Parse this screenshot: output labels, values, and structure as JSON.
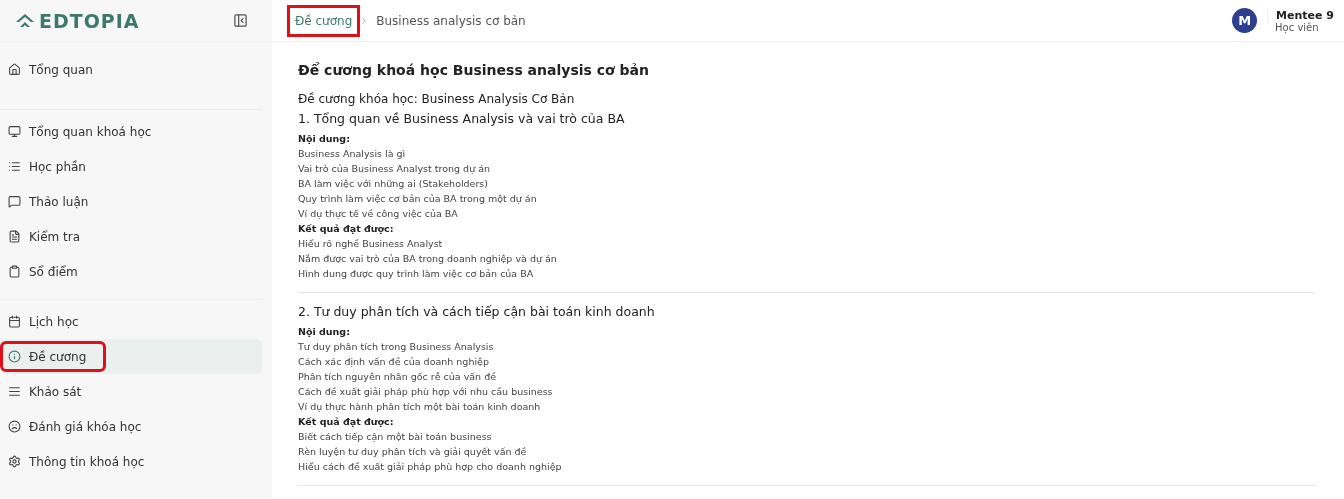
{
  "logo": {
    "text": "EDTOPIA"
  },
  "sidebar": {
    "groups": [
      {
        "items": [
          {
            "label": "Tổng quan",
            "selected": false,
            "highlighted": false
          }
        ]
      },
      {
        "items": [
          {
            "label": "Tổng quan khoá học",
            "selected": false,
            "highlighted": false
          },
          {
            "label": "Học phần",
            "selected": false,
            "highlighted": false
          },
          {
            "label": "Thảo luận",
            "selected": false,
            "highlighted": false
          },
          {
            "label": "Kiểm tra",
            "selected": false,
            "highlighted": false
          },
          {
            "label": "Sổ điểm",
            "selected": false,
            "highlighted": false
          }
        ]
      },
      {
        "items": [
          {
            "label": "Lịch học",
            "selected": false,
            "highlighted": false
          },
          {
            "label": "Đề cương",
            "selected": true,
            "highlighted": true
          },
          {
            "label": "Khảo sát",
            "selected": false,
            "highlighted": false
          },
          {
            "label": "Đánh giá khóa học",
            "selected": false,
            "highlighted": false
          },
          {
            "label": "Thông tin khoá học",
            "selected": false,
            "highlighted": false
          }
        ]
      }
    ]
  },
  "breadcrumb": [
    {
      "label": "Đề cương",
      "link": true,
      "highlighted": true
    },
    {
      "label": "Business analysis cơ bản",
      "link": false,
      "highlighted": false
    }
  ],
  "user": {
    "initial": "M",
    "name": "Mentee 9",
    "role": "Học viên"
  },
  "page": {
    "title": "Để cương khoá học Business analysis cơ bản",
    "intro": "Đề cương khóa học: Business Analysis Cơ Bản",
    "sections": [
      {
        "heading": "1. Tổng quan về Business Analysis và vai trò của BA",
        "groups": [
          {
            "label": "Nội dung:",
            "items": [
              "Business Analysis là gì",
              "Vai trò của Business Analyst trong dự án",
              "BA làm việc với những ai (Stakeholders)",
              "Quy trình làm việc cơ bản của BA trong một dự án",
              "Ví dụ thực tế về công việc của BA"
            ]
          },
          {
            "label": "Kết quả đạt được:",
            "items": [
              "Hiểu rõ nghề Business Analyst",
              "Nắm được vai trò của BA trong doanh nghiệp và dự án",
              "Hình dung được quy trình làm việc cơ bản của BA"
            ]
          }
        ]
      },
      {
        "heading": "2. Tư duy phân tích và cách tiếp cận bài toán kinh doanh",
        "groups": [
          {
            "label": "Nội dung:",
            "items": [
              "Tư duy phân tích trong Business Analysis",
              "Cách xác định vấn đề của doanh nghiệp",
              "Phân tích nguyên nhân gốc rễ của vấn đề",
              "Cách đề xuất giải pháp phù hợp với nhu cầu business",
              "Ví dụ thực hành phân tích một bài toán kinh doanh"
            ]
          },
          {
            "label": "Kết quả đạt được:",
            "items": [
              "Biết cách tiếp cận một bài toán business",
              "Rèn luyện tư duy phân tích và giải quyết vấn đề",
              "Hiểu cách đề xuất giải pháp phù hợp cho doanh nghiệp"
            ]
          }
        ]
      }
    ]
  }
}
